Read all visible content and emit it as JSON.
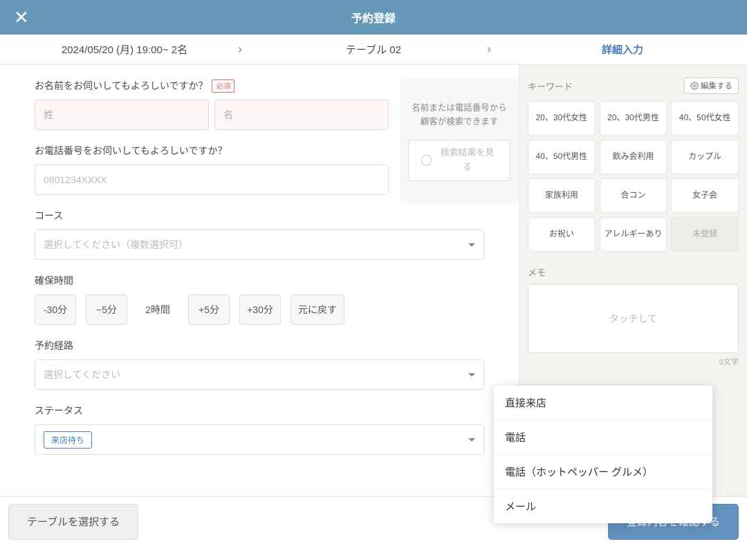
{
  "header": {
    "title": "予約登録"
  },
  "tabs": {
    "datetime": "2024/05/20 (月) 19:00~ 2名",
    "table": "テーブル 02",
    "detail": "詳細入力"
  },
  "form": {
    "name_label": "お名前をお伺いしてもよろしいですか？",
    "required_badge": "必須",
    "lastname_placeholder": "姓",
    "firstname_placeholder": "名",
    "phone_label": "お電話番号をお伺いしてもよろしいですか？",
    "phone_placeholder": "0801234XXXX",
    "course_label": "コース",
    "course_placeholder": "選択してください（複数選択可）",
    "duration_label": "確保時間",
    "duration_buttons": [
      "-30分",
      "−5分",
      "2時間",
      "+5分",
      "+30分",
      "元に戻す"
    ],
    "route_label": "予約経路",
    "route_placeholder": "選択してください",
    "status_label": "ステータス",
    "status_value": "来店待ち",
    "search_hint_line1": "名前または電話番号から",
    "search_hint_line2": "顧客が検索できます",
    "search_button": "検索結果を見る"
  },
  "sidebar": {
    "keyword_label": "キーワード",
    "edit_button": "編集する",
    "keywords": [
      "20、30代女性",
      "20、30代男性",
      "40、50代女性",
      "40、50代男性",
      "飲み会利用",
      "カップル",
      "家族利用",
      "合コン",
      "女子会",
      "お祝い",
      "アレルギーあり",
      "未登録"
    ],
    "memo_label": "メモ",
    "memo_placeholder": "タッチして",
    "char_count": "0文字"
  },
  "route_options": [
    "直接来店",
    "電話",
    "電話（ホットペッパー グルメ）",
    "メール"
  ],
  "footer": {
    "select_table": "テーブルを選択する",
    "confirm": "登録内容を確認する"
  }
}
